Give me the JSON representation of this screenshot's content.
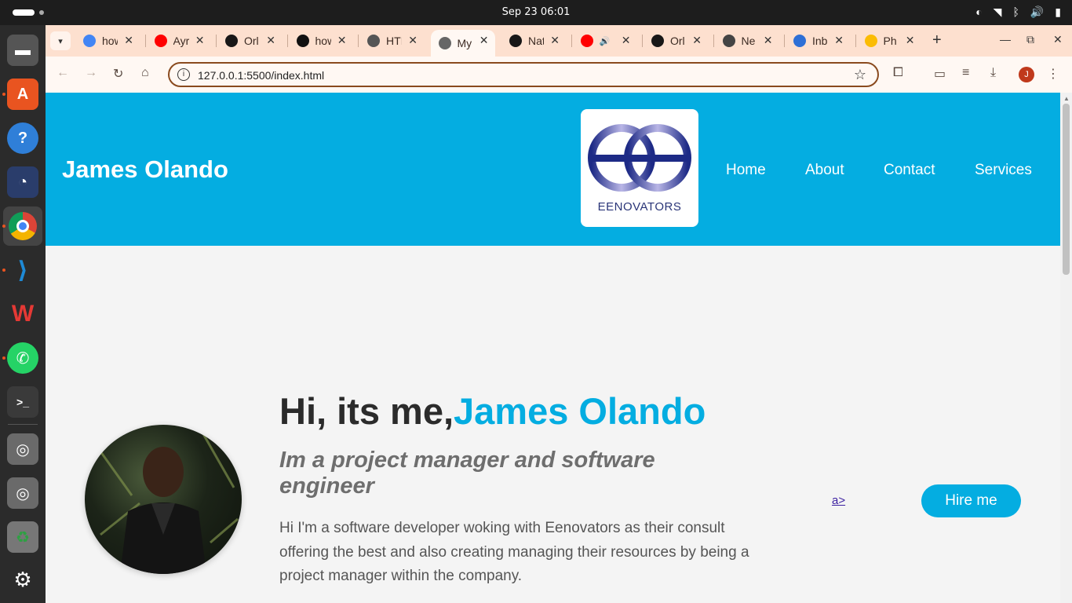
{
  "system": {
    "clock": "Sep 23  06:01"
  },
  "browser": {
    "tabs": [
      {
        "label": "how",
        "favicon": "google-icon",
        "color": "#4285f4"
      },
      {
        "label": "Ayr",
        "favicon": "youtube-icon",
        "color": "#ff0000"
      },
      {
        "label": "Orl",
        "favicon": "github-icon",
        "color": "#181717"
      },
      {
        "label": "how",
        "favicon": "chatgpt-icon",
        "color": "#111111"
      },
      {
        "label": "HTI",
        "favicon": "openai-icon",
        "color": "#555555"
      },
      {
        "label": "My",
        "favicon": "globe-icon",
        "color": "#666666",
        "active": true
      },
      {
        "label": "Nat",
        "favicon": "github-icon",
        "color": "#181717"
      },
      {
        "label": "",
        "favicon": "youtube-icon",
        "color": "#ff0000",
        "audio": true
      },
      {
        "label": "Orl",
        "favicon": "github-icon",
        "color": "#181717"
      },
      {
        "label": "Ne",
        "favicon": "chrome-icon",
        "color": "#444444"
      },
      {
        "label": "Inb",
        "favicon": "mail-icon",
        "color": "#2d6fd6"
      },
      {
        "label": "Ph",
        "favicon": "photos-icon",
        "color": "#fbbc04"
      }
    ],
    "url": "127.0.0.1:5500/index.html",
    "profile_initial": "J"
  },
  "site": {
    "name": "James Olando",
    "logo_text": "EENOVATORS",
    "nav": [
      "Home",
      "About",
      "Contact",
      "Services"
    ],
    "hero": {
      "greeting": "Hi, its me,",
      "highlight_name": "James Olando",
      "subtitle": "Im a project manager and software engineer",
      "body": "Hi I'm a software developer woking with Eenovators as their consult offering the best and also creating managing their resources by being a project manager within the company.",
      "stray_link": "a>",
      "cta": "Hire me"
    },
    "colors": {
      "accent": "#04ade1",
      "page_bg": "#f4f4f4"
    }
  }
}
